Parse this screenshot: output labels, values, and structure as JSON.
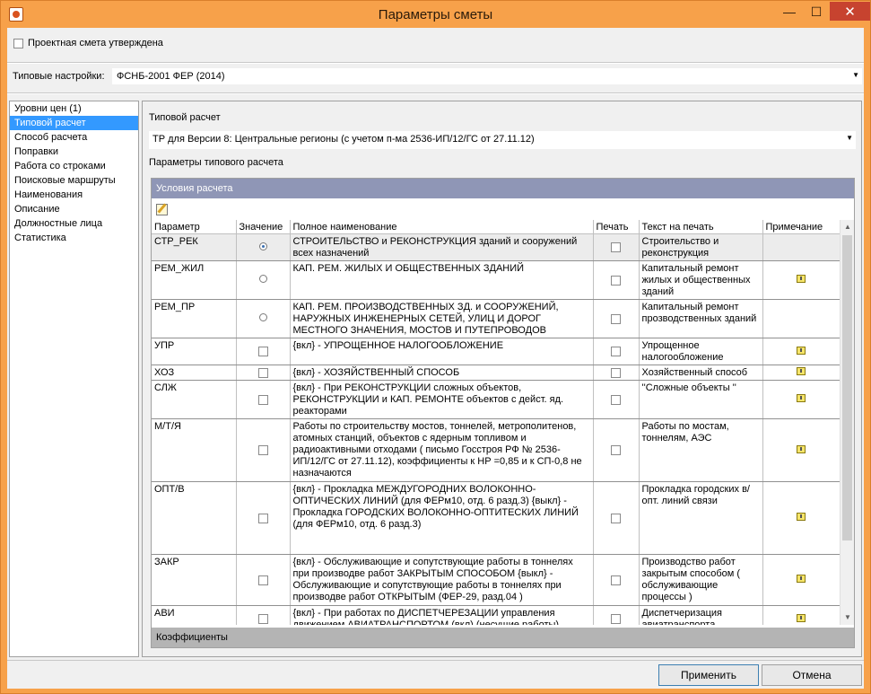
{
  "window": {
    "title": "Параметры сметы",
    "minimize": "—",
    "maximize": "☐",
    "close": "✕"
  },
  "approved": {
    "label": "Проектная смета утверждена",
    "checked": false
  },
  "preset": {
    "label": "Типовые настройки:",
    "value": "ФСНБ-2001 ФЕР (2014)"
  },
  "sidebar": {
    "items": [
      {
        "label": "Уровни цен (1)"
      },
      {
        "label": "Типовой расчет",
        "active": true
      },
      {
        "label": "Способ расчета"
      },
      {
        "label": "Поправки"
      },
      {
        "label": "Работа со строками"
      },
      {
        "label": "Поисковые маршруты"
      },
      {
        "label": "Наименования"
      },
      {
        "label": "Описание"
      },
      {
        "label": "Должностные лица"
      },
      {
        "label": "Статистика"
      }
    ]
  },
  "calc": {
    "section_label": "Типовой расчет",
    "value": "ТР для Версии 8: Центральные регионы (с учетом п-ма 2536-ИП/12/ГС от 27.11.12)",
    "params_label": "Параметры типового расчета",
    "conditions_header": "Условия расчета",
    "coefficients_header": "Коэффициенты"
  },
  "table": {
    "headers": {
      "param": "Параметр",
      "value": "Значение",
      "full_name": "Полное наименование",
      "print": "Печать",
      "print_text": "Текст на печать",
      "note": "Примечание"
    },
    "rows": [
      {
        "param": "СТР_РЕК",
        "kind": "radio",
        "selected": true,
        "full_name": "СТРОИТЕЛЬСТВО и РЕКОНСТРУКЦИЯ  зданий и сооружений всех назначений",
        "print_text": "Строительство и реконструкция",
        "note": false
      },
      {
        "param": "РЕМ_ЖИЛ",
        "kind": "radio",
        "selected": false,
        "full_name": "КАП. РЕМ. ЖИЛЫХ И ОБЩЕСТВЕННЫХ ЗДАНИЙ",
        "print_text": "Капитальный ремонт жилых и общественных зданий",
        "note": true
      },
      {
        "param": "РЕМ_ПР",
        "kind": "radio",
        "selected": false,
        "full_name": "КАП. РЕМ. ПРОИЗВОДСТВЕННЫХ ЗД. и СООРУЖЕНИЙ, НАРУЖНЫХ ИНЖЕНЕРНЫХ СЕТЕЙ, УЛИЦ И ДОРОГ МЕСТНОГО ЗНАЧЕНИЯ, МОСТОВ И ПУТЕПРОВОДОВ",
        "print_text": "Капитальный ремонт прозводственных зданий",
        "note": false
      },
      {
        "param": "УПР",
        "kind": "check",
        "selected": false,
        "full_name": "{вкл} - УПРОЩЕННОЕ НАЛОГООБЛОЖЕНИЕ",
        "print_text": "Упрощенное налогообложение",
        "note": true
      },
      {
        "param": "ХОЗ",
        "kind": "check",
        "selected": false,
        "full_name": "{вкл} - ХОЗЯЙСТВЕННЫЙ СПОСОБ",
        "print_text": "Хозяйственный способ",
        "note": true
      },
      {
        "param": "СЛЖ",
        "kind": "check",
        "selected": false,
        "full_name": "{вкл} -  При  РЕКОНСТРУКЦИИ сложных объектов, РЕКОНСТРУКЦИИ и КАП. РЕМОНТЕ объектов с дейст. яд. реакторами",
        "print_text": "''Сложные объекты ''",
        "note": true
      },
      {
        "param": "М/Т/Я",
        "kind": "check",
        "selected": false,
        "full_name": "Работы по строительству мостов, тоннелей, метрополитенов, атомных станций, объектов с ядерным топливом и радиоактивными отходами ( письмо Госстроя РФ № 2536-ИП/12/ГС от 27.11.12), коэффициенты к НР =0,85 и к СП-0,8 не назначаются",
        "print_text": "Работы по мостам, тоннелям, АЭС",
        "note": true
      },
      {
        "param": "ОПТ/В",
        "kind": "check",
        "selected": false,
        "full_name": "{вкл}   - Прокладка  МЕЖДУГОРОДНИХ ВОЛОКОННО-ОПТИЧЕСКИХ ЛИНИЙ (для ФЕРм10, отд. 6 разд.3) {выкл} - Прокладка  ГОРОДСКИХ ВОЛОКОННО-ОПТИТЕСКИХ ЛИНИЙ  (для ФЕРм10, отд. 6 разд.3)",
        "print_text": "Прокладка городских в/опт. линий связи",
        "note": true
      },
      {
        "param": "ЗАКР",
        "kind": "check",
        "selected": false,
        "full_name": "{вкл}  -  Обслуживающие и сопутствующие работы в тоннелях при производве работ ЗАКРЫТЫМ СПОСОБОМ {выкл} - Обслуживающие и сопутствующие работы в тоннелях при производве работ  ОТКРЫТЫМ                     (ФЕР-29, разд.04 )",
        "print_text": "Производство работ закрытым способом ( обслуживающие процессы )",
        "note": true
      },
      {
        "param": "АВИ",
        "kind": "check",
        "selected": false,
        "full_name": "{вкл}  -  При работах по ДИСПЕТЧЕРЕЗАЦИИ управления движением АВИАТРАНСПОРТОМ (вкл) (несущие работы)",
        "print_text": "Диспетчеризация авиатранспорта",
        "note": true
      }
    ]
  },
  "buttons": {
    "apply": "Применить",
    "cancel": "Отмена"
  },
  "colors": {
    "titlebar": "#f7a14a",
    "selection": "#3399ff",
    "group_header": "#8f96b6",
    "close_button": "#c7432f"
  }
}
